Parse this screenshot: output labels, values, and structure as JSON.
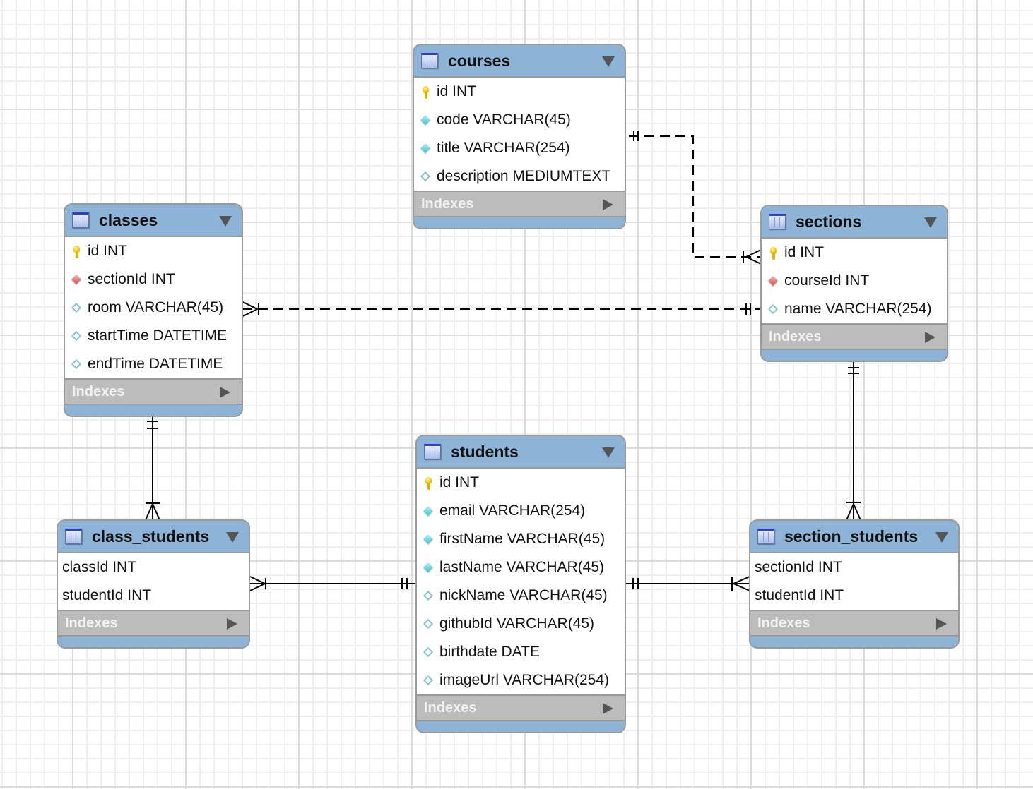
{
  "diagram": {
    "type": "EER diagram",
    "tables": [
      {
        "key": "courses",
        "name": "courses",
        "columns": [
          {
            "icon": "primary-key-icon",
            "text": "id INT"
          },
          {
            "icon": "not-null-column-icon",
            "text": "code VARCHAR(45)"
          },
          {
            "icon": "not-null-column-icon",
            "text": "title VARCHAR(254)"
          },
          {
            "icon": "nullable-column-icon",
            "text": "description MEDIUMTEXT"
          }
        ],
        "indexes_label": "Indexes"
      },
      {
        "key": "classes",
        "name": "classes",
        "columns": [
          {
            "icon": "primary-key-icon",
            "text": "id INT"
          },
          {
            "icon": "foreign-key-icon",
            "text": "sectionId INT"
          },
          {
            "icon": "nullable-column-icon",
            "text": "room VARCHAR(45)"
          },
          {
            "icon": "nullable-column-icon",
            "text": "startTime DATETIME"
          },
          {
            "icon": "nullable-column-icon",
            "text": "endTime DATETIME"
          }
        ],
        "indexes_label": "Indexes"
      },
      {
        "key": "sections",
        "name": "sections",
        "columns": [
          {
            "icon": "primary-key-icon",
            "text": "id INT"
          },
          {
            "icon": "foreign-key-icon",
            "text": "courseId INT"
          },
          {
            "icon": "nullable-column-icon",
            "text": "name VARCHAR(254)"
          }
        ],
        "indexes_label": "Indexes"
      },
      {
        "key": "students",
        "name": "students",
        "columns": [
          {
            "icon": "primary-key-icon",
            "text": "id INT"
          },
          {
            "icon": "not-null-column-icon",
            "text": "email VARCHAR(254)"
          },
          {
            "icon": "not-null-column-icon",
            "text": "firstName VARCHAR(45)"
          },
          {
            "icon": "not-null-column-icon",
            "text": "lastName VARCHAR(45)"
          },
          {
            "icon": "nullable-column-icon",
            "text": "nickName VARCHAR(45)"
          },
          {
            "icon": "nullable-column-icon",
            "text": "githubId VARCHAR(45)"
          },
          {
            "icon": "nullable-column-icon",
            "text": "birthdate DATE"
          },
          {
            "icon": "nullable-column-icon",
            "text": "imageUrl VARCHAR(254)"
          }
        ],
        "indexes_label": "Indexes"
      },
      {
        "key": "class_students",
        "name": "class_students",
        "columns": [
          {
            "icon": "none",
            "text": "classId INT"
          },
          {
            "icon": "none",
            "text": "studentId INT"
          }
        ],
        "indexes_label": "Indexes"
      },
      {
        "key": "section_students",
        "name": "section_students",
        "columns": [
          {
            "icon": "none",
            "text": "sectionId INT"
          },
          {
            "icon": "none",
            "text": "studentId INT"
          }
        ],
        "indexes_label": "Indexes"
      }
    ],
    "relationships": [
      {
        "from": "courses",
        "to": "sections",
        "from_cardinality": "one-and-only-one",
        "to_cardinality": "one-or-many",
        "style": "dashed"
      },
      {
        "from": "sections",
        "to": "classes",
        "from_cardinality": "one-and-only-one",
        "to_cardinality": "one-or-many",
        "style": "dashed"
      },
      {
        "from": "classes",
        "to": "class_students",
        "from_cardinality": "one-and-only-one",
        "to_cardinality": "one-or-many",
        "style": "solid"
      },
      {
        "from": "students",
        "to": "class_students",
        "from_cardinality": "one-and-only-one",
        "to_cardinality": "one-or-many",
        "style": "solid"
      },
      {
        "from": "students",
        "to": "section_students",
        "from_cardinality": "one-and-only-one",
        "to_cardinality": "one-or-many",
        "style": "solid"
      },
      {
        "from": "sections",
        "to": "section_students",
        "from_cardinality": "one-and-only-one",
        "to_cardinality": "one-or-many",
        "style": "solid"
      }
    ]
  }
}
